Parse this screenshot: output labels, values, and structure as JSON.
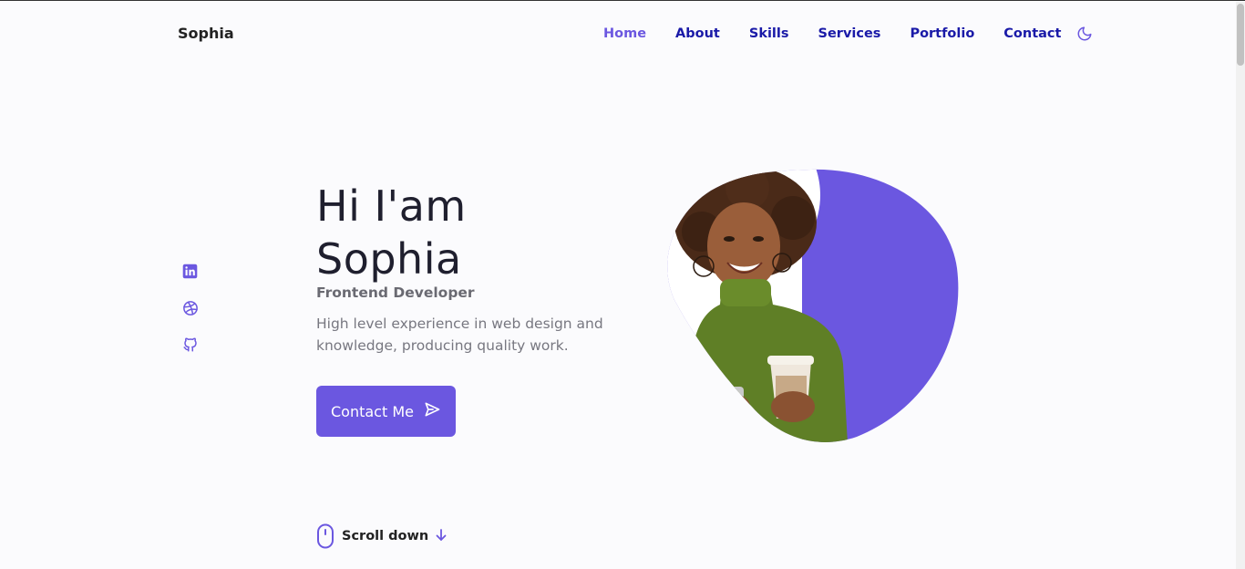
{
  "header": {
    "brand": "Sophia",
    "nav": [
      {
        "label": "Home",
        "active": true
      },
      {
        "label": "About",
        "active": false
      },
      {
        "label": "Skills",
        "active": false
      },
      {
        "label": "Services",
        "active": false
      },
      {
        "label": "Portfolio",
        "active": false
      },
      {
        "label": "Contact",
        "active": false
      }
    ],
    "theme_toggle_icon": "moon-icon"
  },
  "hero": {
    "title_line1": "Hi I'am",
    "title_line2": "Sophia",
    "subtitle": "Frontend Developer",
    "description": "High level experience in web design and knowledge, producing quality work.",
    "cta_label": "Contact Me",
    "cta_icon": "send-icon"
  },
  "socials": [
    {
      "icon": "linkedin-icon"
    },
    {
      "icon": "dribbble-icon"
    },
    {
      "icon": "github-icon"
    }
  ],
  "scroll": {
    "label": "Scroll down",
    "icons": [
      "mouse-icon",
      "arrow-down-icon"
    ]
  },
  "colors": {
    "accent": "#6b57e0",
    "nav_link": "#1a1aa8",
    "background": "#fbfbfd",
    "text": "#1f1f2e",
    "muted": "#777780"
  }
}
